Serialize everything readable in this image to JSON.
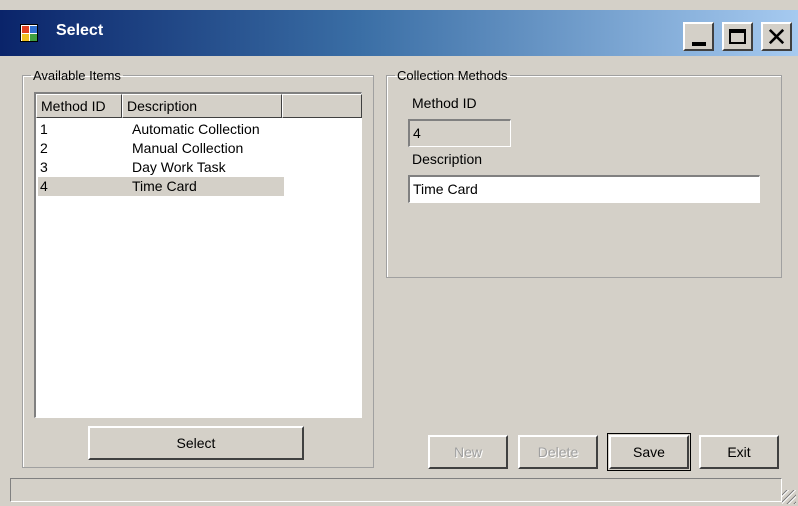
{
  "window": {
    "title": "Select",
    "controls": {
      "minimize_icon": "minimize-icon",
      "maximize_icon": "maximize-icon",
      "close_glyph": "✕"
    }
  },
  "available_items": {
    "legend": "Available Items",
    "columns": [
      "Method ID",
      "Description",
      ""
    ],
    "rows": [
      {
        "id": "1",
        "description": "Automatic  Collection"
      },
      {
        "id": "2",
        "description": "Manual  Collection"
      },
      {
        "id": "3",
        "description": "Day Work Task"
      },
      {
        "id": "4",
        "description": "Time Card"
      }
    ],
    "selected_index": 3,
    "select_button": "Select"
  },
  "collection_methods": {
    "legend": "Collection Methods",
    "method_id_label": "Method ID",
    "method_id_value": "4",
    "description_label": "Description",
    "description_value": "Time Card"
  },
  "actions": {
    "new": "New",
    "delete": "Delete",
    "save": "Save",
    "exit": "Exit"
  },
  "status": {
    "text": ""
  },
  "colors": {
    "window_bg": "#d4d0c8",
    "title_start": "#0a246a",
    "title_end": "#a6caf0"
  }
}
